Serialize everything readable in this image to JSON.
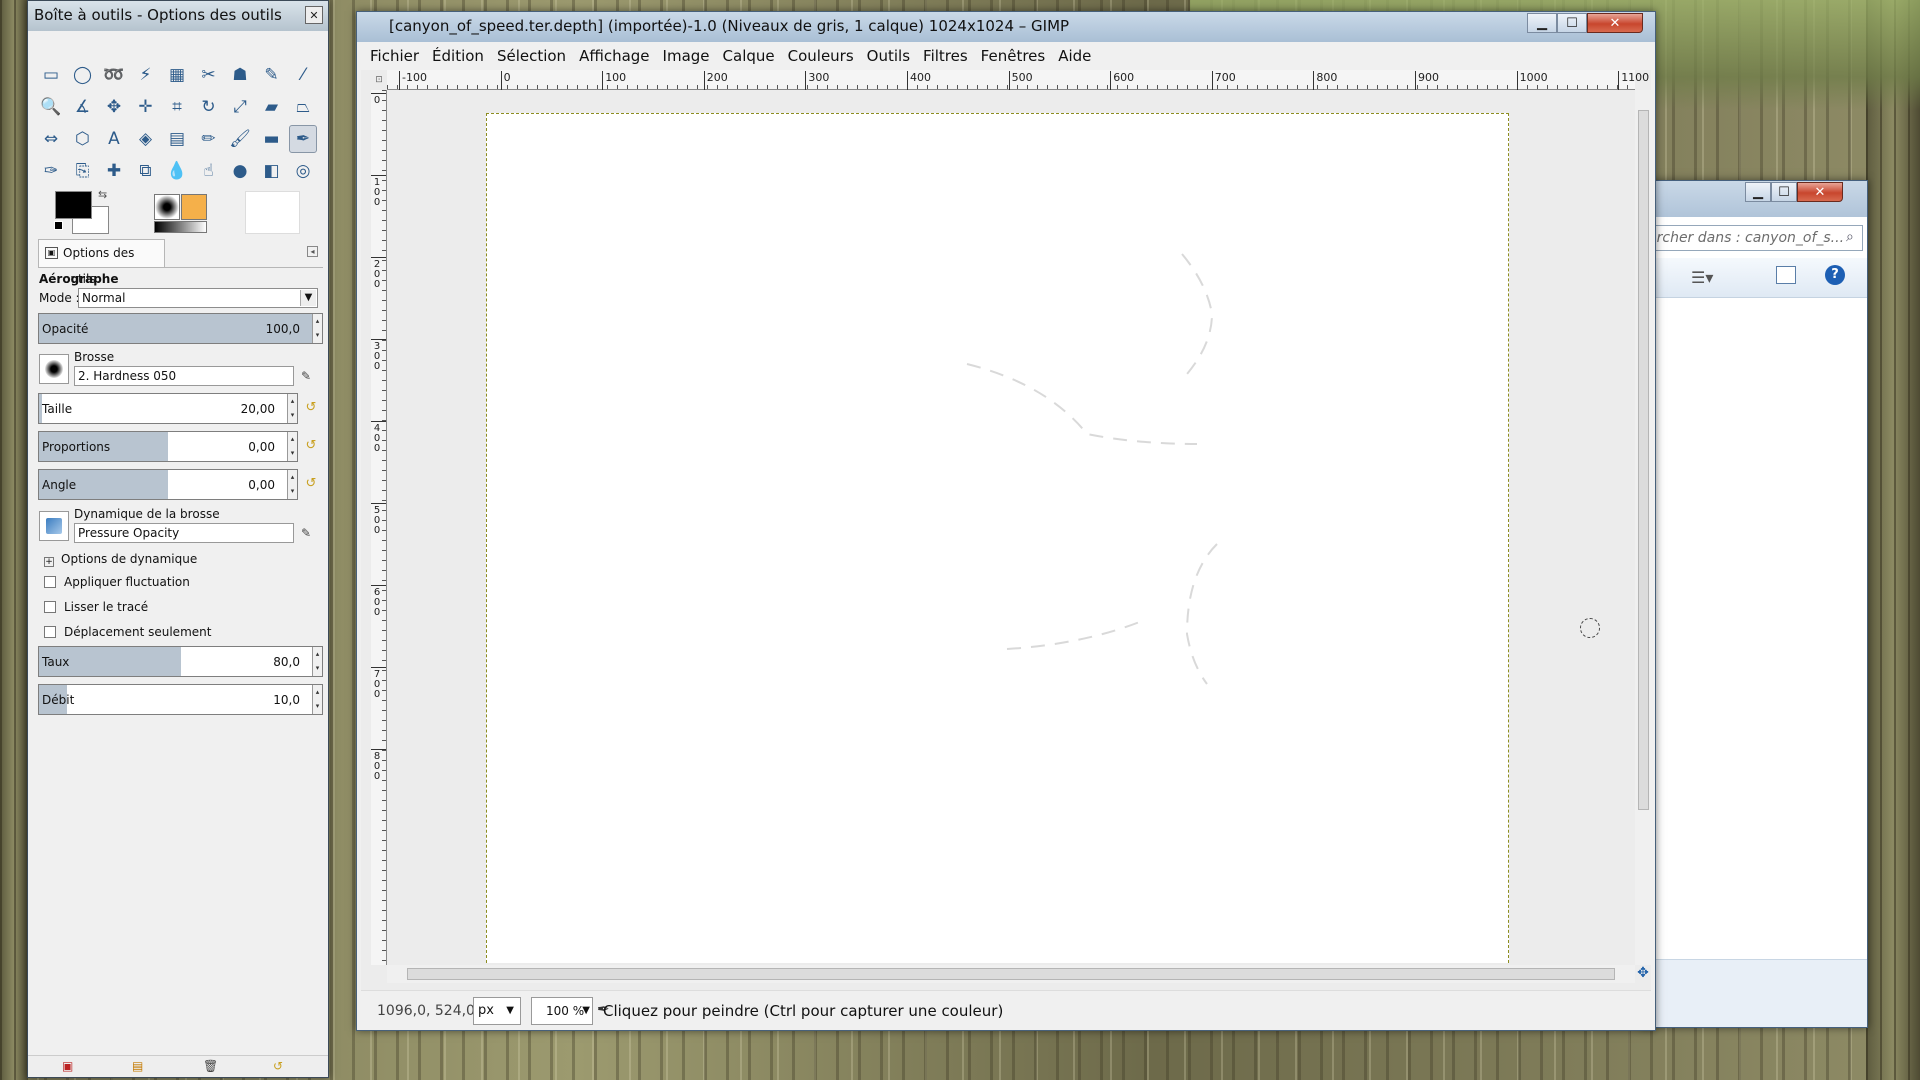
{
  "toolbox": {
    "title": "Boîte à outils - Options des outils",
    "close": "✕",
    "tools": [
      {
        "icon": "rect-select-icon",
        "glyph": "▭"
      },
      {
        "icon": "ellipse-select-icon",
        "glyph": "◯"
      },
      {
        "icon": "lasso-icon",
        "glyph": "➿"
      },
      {
        "icon": "fuzzy-select-icon",
        "glyph": "⚡"
      },
      {
        "icon": "color-select-icon",
        "glyph": "▦"
      },
      {
        "icon": "scissors-icon",
        "glyph": "✂"
      },
      {
        "icon": "foreground-select-icon",
        "glyph": "☗"
      },
      {
        "icon": "paths-icon",
        "glyph": "✎"
      },
      {
        "icon": "color-picker-icon",
        "glyph": "⁄"
      },
      {
        "icon": "zoom-icon",
        "glyph": "🔍"
      },
      {
        "icon": "measure-icon",
        "glyph": "∡"
      },
      {
        "icon": "move-icon",
        "glyph": "✥"
      },
      {
        "icon": "align-icon",
        "glyph": "✛"
      },
      {
        "icon": "crop-icon",
        "glyph": "⌗"
      },
      {
        "icon": "rotate-icon",
        "glyph": "↻"
      },
      {
        "icon": "scale-icon",
        "glyph": "⤢"
      },
      {
        "icon": "shear-icon",
        "glyph": "▰"
      },
      {
        "icon": "perspective-icon",
        "glyph": "⏢"
      },
      {
        "icon": "flip-icon",
        "glyph": "⇔"
      },
      {
        "icon": "cage-icon",
        "glyph": "⬡"
      },
      {
        "icon": "text-icon",
        "glyph": "A"
      },
      {
        "icon": "bucket-fill-icon",
        "glyph": "◈"
      },
      {
        "icon": "blend-icon",
        "glyph": "▤"
      },
      {
        "icon": "pencil-icon",
        "glyph": "✏"
      },
      {
        "icon": "paintbrush-icon",
        "glyph": "🖌"
      },
      {
        "icon": "eraser-icon",
        "glyph": "▬"
      },
      {
        "icon": "airbrush-icon",
        "glyph": "✒"
      },
      {
        "icon": "ink-icon",
        "glyph": "✑"
      },
      {
        "icon": "clone-icon",
        "glyph": "⎘"
      },
      {
        "icon": "heal-icon",
        "glyph": "✚"
      },
      {
        "icon": "perspective-clone-icon",
        "glyph": "⧉"
      },
      {
        "icon": "blur-icon",
        "glyph": "💧"
      },
      {
        "icon": "smudge-icon",
        "glyph": "☝"
      },
      {
        "icon": "dodge-burn-icon",
        "glyph": "●"
      },
      {
        "icon": "color-ops-icon",
        "glyph": "◧"
      },
      {
        "icon": "spiral-icon",
        "glyph": "◎"
      }
    ],
    "active_tool_index": 26,
    "tab_label": "Options des outils",
    "tool_name": "Aérographe",
    "mode_label": "Mode :",
    "mode_value": "Normal",
    "opacity": {
      "label": "Opacité",
      "value": "100,0",
      "fraction": 1.0
    },
    "brush_label": "Brosse",
    "brush_value": "2. Hardness 050",
    "size": {
      "label": "Taille",
      "value": "20,00",
      "fraction": 0.01
    },
    "aspect": {
      "label": "Proportions",
      "value": "0,00",
      "fraction": 0.5
    },
    "angle": {
      "label": "Angle",
      "value": "0,00",
      "fraction": 0.5
    },
    "dynamics_label": "Dynamique de la brosse",
    "dynamics_value": "Pressure Opacity",
    "dynamics_options": "Options de dynamique",
    "checks": [
      "Appliquer fluctuation",
      "Lisser le tracé",
      "Déplacement seulement"
    ],
    "rate": {
      "label": "Taux",
      "value": "80,0",
      "fraction": 0.5
    },
    "flow": {
      "label": "Débit",
      "value": "10,0",
      "fraction": 0.1
    }
  },
  "gimp": {
    "title": "[canyon_of_speed.ter.depth] (importée)-1.0 (Niveaux de gris, 1 calque) 1024x1024 – GIMP",
    "menus": [
      "Fichier",
      "Édition",
      "Sélection",
      "Affichage",
      "Image",
      "Calque",
      "Couleurs",
      "Outils",
      "Filtres",
      "Fenêtres",
      "Aide"
    ],
    "ruler_h": [
      "-100",
      "0",
      "100",
      "200",
      "300",
      "400",
      "500",
      "600",
      "700",
      "800",
      "900",
      "1000",
      "1100"
    ],
    "ruler_v": [
      "0",
      "100",
      "200",
      "300",
      "400",
      "500",
      "600",
      "700",
      "800"
    ],
    "coords": "1096,0, 524,0",
    "unit": "px",
    "zoom": "100 %",
    "status_message": "Cliquez pour peindre (Ctrl pour capturer une couleur)"
  },
  "explorer": {
    "search_placeholder": "ercher dans : canyon_of_s..."
  }
}
